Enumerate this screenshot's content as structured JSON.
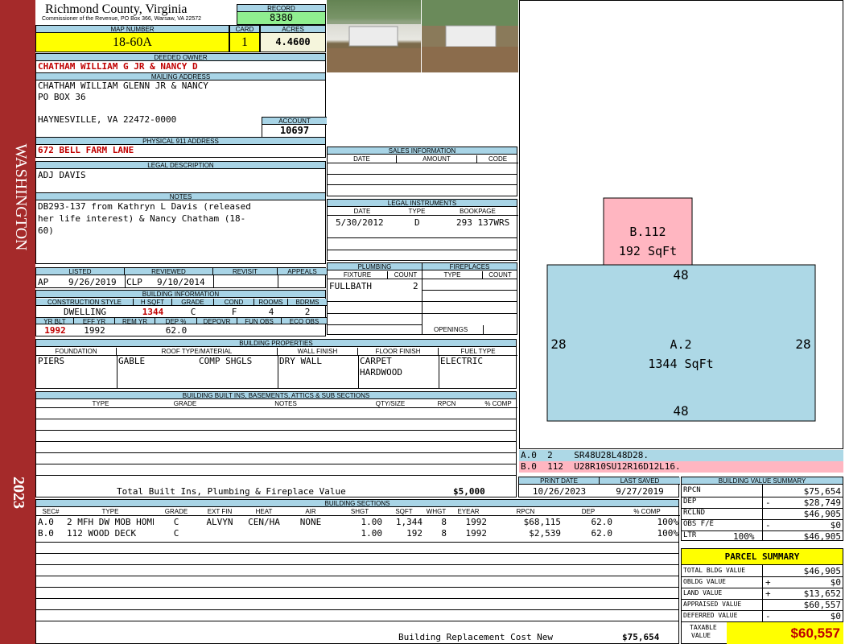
{
  "side": {
    "left_text": "WASHINGTON",
    "year": "2023"
  },
  "header": {
    "county": "Richmond County, Virginia",
    "commissioner": "Commissioner of the Revenue, PO Box 366, Warsaw, VA 22572",
    "record_label": "RECORD",
    "record": "8380",
    "map_label": "MAP NUMBER",
    "map": "18-60A",
    "card_label": "CARD",
    "card": "1",
    "acres_label": "ACRES",
    "acres": "4.4600"
  },
  "owner": {
    "label": "DEEDED OWNER",
    "name": "CHATHAM WILLIAM G JR & NANCY D",
    "mail_label": "MAILING ADDRESS",
    "mail1": "CHATHAM WILLIAM GLENN JR & NANCY",
    "mail2": "PO BOX 36",
    "mail3": "HAYNESVILLE, VA 22472-0000",
    "acct_label": "ACCOUNT",
    "account": "10697",
    "addr_label": "PHYSICAL 911 ADDRESS",
    "address": "672 BELL FARM LANE"
  },
  "legal": {
    "label": "LEGAL DESCRIPTION",
    "text": "ADJ DAVIS"
  },
  "notes": {
    "label": "NOTES",
    "l1": "DB293-137 from Kathryn L Davis (released",
    "l2": "her life interest) & Nancy Chatham (18-",
    "l3": "60)"
  },
  "status": {
    "h": [
      "LISTED",
      "REVIEWED",
      "REVISIT",
      "APPEALS"
    ],
    "listed_by": "AP",
    "listed": "9/26/2019",
    "rev_by": "CLP",
    "reviewed": "9/10/2014"
  },
  "bldg_info": {
    "label": "BUILDING INFORMATION",
    "h1": [
      "CONSTRUCTION STYLE",
      "H SQFT",
      "GRADE",
      "COND",
      "ROOMS",
      "BDRMS"
    ],
    "v1": [
      "DWELLING",
      "1344",
      "C",
      "F",
      "4",
      "2"
    ],
    "h2": [
      "YR BLT",
      "EFF YR",
      "REM YR",
      "DEP %",
      "DEPOVR",
      "FUN OBS",
      "ECO OBS"
    ],
    "v2": [
      "1992",
      "1992",
      "",
      "62.0",
      "",
      "",
      ""
    ]
  },
  "sales": {
    "label": "SALES INFORMATION",
    "h": [
      "DATE",
      "AMOUNT",
      "CODE"
    ]
  },
  "instruments": {
    "label": "LEGAL INSTRUMENTS",
    "h": [
      "DATE",
      "TYPE",
      "BOOKPAGE"
    ],
    "date": "5/30/2012",
    "type": "D",
    "book": "293 137WRS"
  },
  "plumbing": {
    "label": "PLUMBING",
    "h": [
      "FIXTURE",
      "COUNT"
    ],
    "fixture": "FULLBATH",
    "count": "2"
  },
  "fireplaces": {
    "label": "FIREPLACES",
    "h": [
      "TYPE",
      "COUNT"
    ],
    "openings": "OPENINGS"
  },
  "props": {
    "label": "BUILDING PROPERTIES",
    "h": [
      "FOUNDATION",
      "ROOF TYPE/MATERIAL",
      "WALL FINISH",
      "FLOOR FINISH",
      "FUEL TYPE"
    ],
    "foundation": "PIERS",
    "roof1": "GABLE",
    "roof2": "COMP SHGLS",
    "wall": "DRY WALL",
    "floor1": "CARPET",
    "floor2": "HARDWOOD",
    "fuel": "ELECTRIC"
  },
  "builtins": {
    "label": "BUILDING BUILT INS, BASEMENTS, ATTICS & SUB SECTIONS",
    "h": [
      "TYPE",
      "GRADE",
      "NOTES",
      "QTY/SIZE",
      "RPCN",
      "% COMP"
    ],
    "total_label": "Total Built Ins, Plumbing & Fireplace Value",
    "total": "$5,000"
  },
  "print": {
    "h1": "PRINT DATE",
    "h2": "LAST SAVED",
    "d1": "10/26/2023",
    "d2": "9/27/2019"
  },
  "sketch": {
    "b_label": "B.112",
    "b_area": "192 SqFt",
    "a_label": "A.2",
    "a_area": "1344 SqFt",
    "top": "48",
    "bottom": "48",
    "left": "28",
    "right": "28",
    "code_a": "A.0  2    SR48U28L48D28.",
    "code_b": "B.0  112  U28R10SU12R16D12L16."
  },
  "sections": {
    "label": "BUILDING SECTIONS",
    "h": [
      "SEC#",
      "TYPE",
      "GRADE",
      "EXT FIN",
      "HEAT",
      "AIR",
      "SHGT",
      "SQFT",
      "WHGT",
      "EYEAR",
      "RPCN",
      "DEP",
      "% COMP"
    ],
    "rows": [
      [
        "A.0",
        "2 MFH DW MOB HOME",
        "C",
        "ALVYN",
        "CEN/HA",
        "NONE",
        "1.00",
        "1,344",
        "8",
        "1992",
        "$68,115",
        "62.0",
        "100%"
      ],
      [
        "B.0",
        "112 WOOD DECK",
        "C",
        "",
        "",
        "",
        "1.00",
        "192",
        "8",
        "1992",
        "$2,539",
        "62.0",
        "100%"
      ]
    ],
    "replacement_label": "Building Replacement Cost New",
    "replacement": "$75,654"
  },
  "bvs": {
    "label": "BUILDING VALUE SUMMARY",
    "rpcn_l": "RPCN",
    "rpcn": "$75,654",
    "dep_l": "DEP",
    "dep_s": "-",
    "dep": "$28,749",
    "rclnd_l": "RCLND",
    "rclnd": "$46,905",
    "obs_l": "OBS F/E",
    "obs_s": "-",
    "obs": "$0",
    "ltr_l": "LTR",
    "ltr_p": "100%",
    "ltr": "$46,905"
  },
  "parcel": {
    "label": "PARCEL SUMMARY",
    "tb_l": "TOTAL BLDG VALUE",
    "tb": "$46,905",
    "ob_l": "OBLDG VALUE",
    "ob_s": "+",
    "ob": "$0",
    "lv_l": "LAND VALUE",
    "lv_s": "+",
    "lv": "$13,652",
    "av_l": "APPRAISED VALUE",
    "av": "$60,557",
    "dv_l": "DEFERRED VALUE",
    "dv_s": "-",
    "dv": "$0",
    "tx_l1": "TAXABLE",
    "tx_l2": "VALUE",
    "taxable": "$60,557"
  },
  "colors": {
    "sidebar": "#a52a2a",
    "header_bar": "#a8d4e6",
    "highlight": "#ffff00",
    "record_green": "#90ee90",
    "sketch_blue": "#add8e6",
    "sketch_pink": "#ffb6c1"
  }
}
